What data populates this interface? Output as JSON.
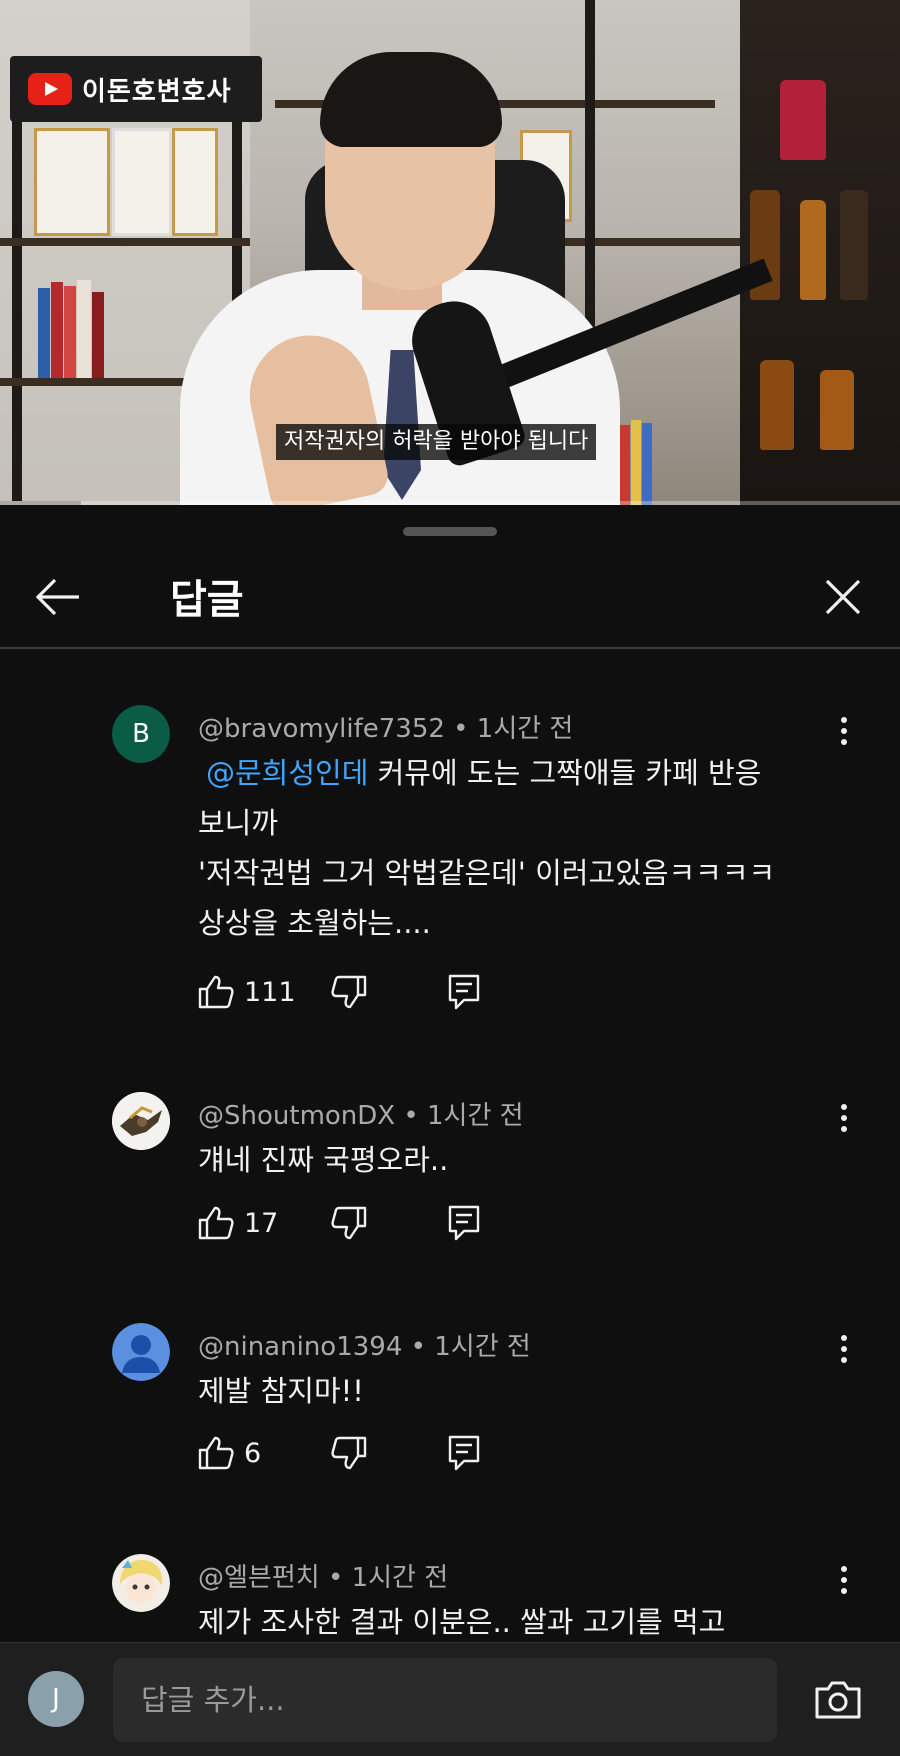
{
  "video": {
    "channel_sign_text": "이돈호변호사",
    "subtitle": "저작권자의 허락을 받아야 됩니다",
    "progress_fraction": 0.09
  },
  "panel": {
    "title": "답글",
    "back_icon": "arrow-left-icon",
    "close_icon": "close-icon"
  },
  "comments": [
    {
      "author": "@bravomylife7352",
      "time": "1시간 전",
      "avatar_letter": "B",
      "avatar_color": "#0a5c45",
      "mention": "@문희성인데",
      "lines": [
        " 커뮤에 도는 그짝애들 카페 반응",
        "보니까",
        "'저작권법 그거 악법같은데' 이러고있음ㅋㅋㅋㅋ",
        "상상을 초월하는...."
      ],
      "likes": "111"
    },
    {
      "author": "@ShoutmonDX",
      "time": "1시간 전",
      "lines": [
        "걔네 진짜 국평오라.."
      ],
      "likes": "17"
    },
    {
      "author": "@ninanino1394",
      "time": "1시간 전",
      "avatar_color": "#5b8fe0",
      "lines": [
        "제발 참지마!!"
      ],
      "likes": "6"
    },
    {
      "author": "@엘븐펀치",
      "time": "1시간 전",
      "lines": [
        "제가 조사한 결과 이분은.. 쌀과 고기를 먹고"
      ]
    }
  ],
  "reply_bar": {
    "user_initial": "J",
    "placeholder": "답글 추가..."
  },
  "colors": {
    "background": "#0f0f0f",
    "mention": "#3ea6ff",
    "meta_text": "#aaaaaa"
  }
}
